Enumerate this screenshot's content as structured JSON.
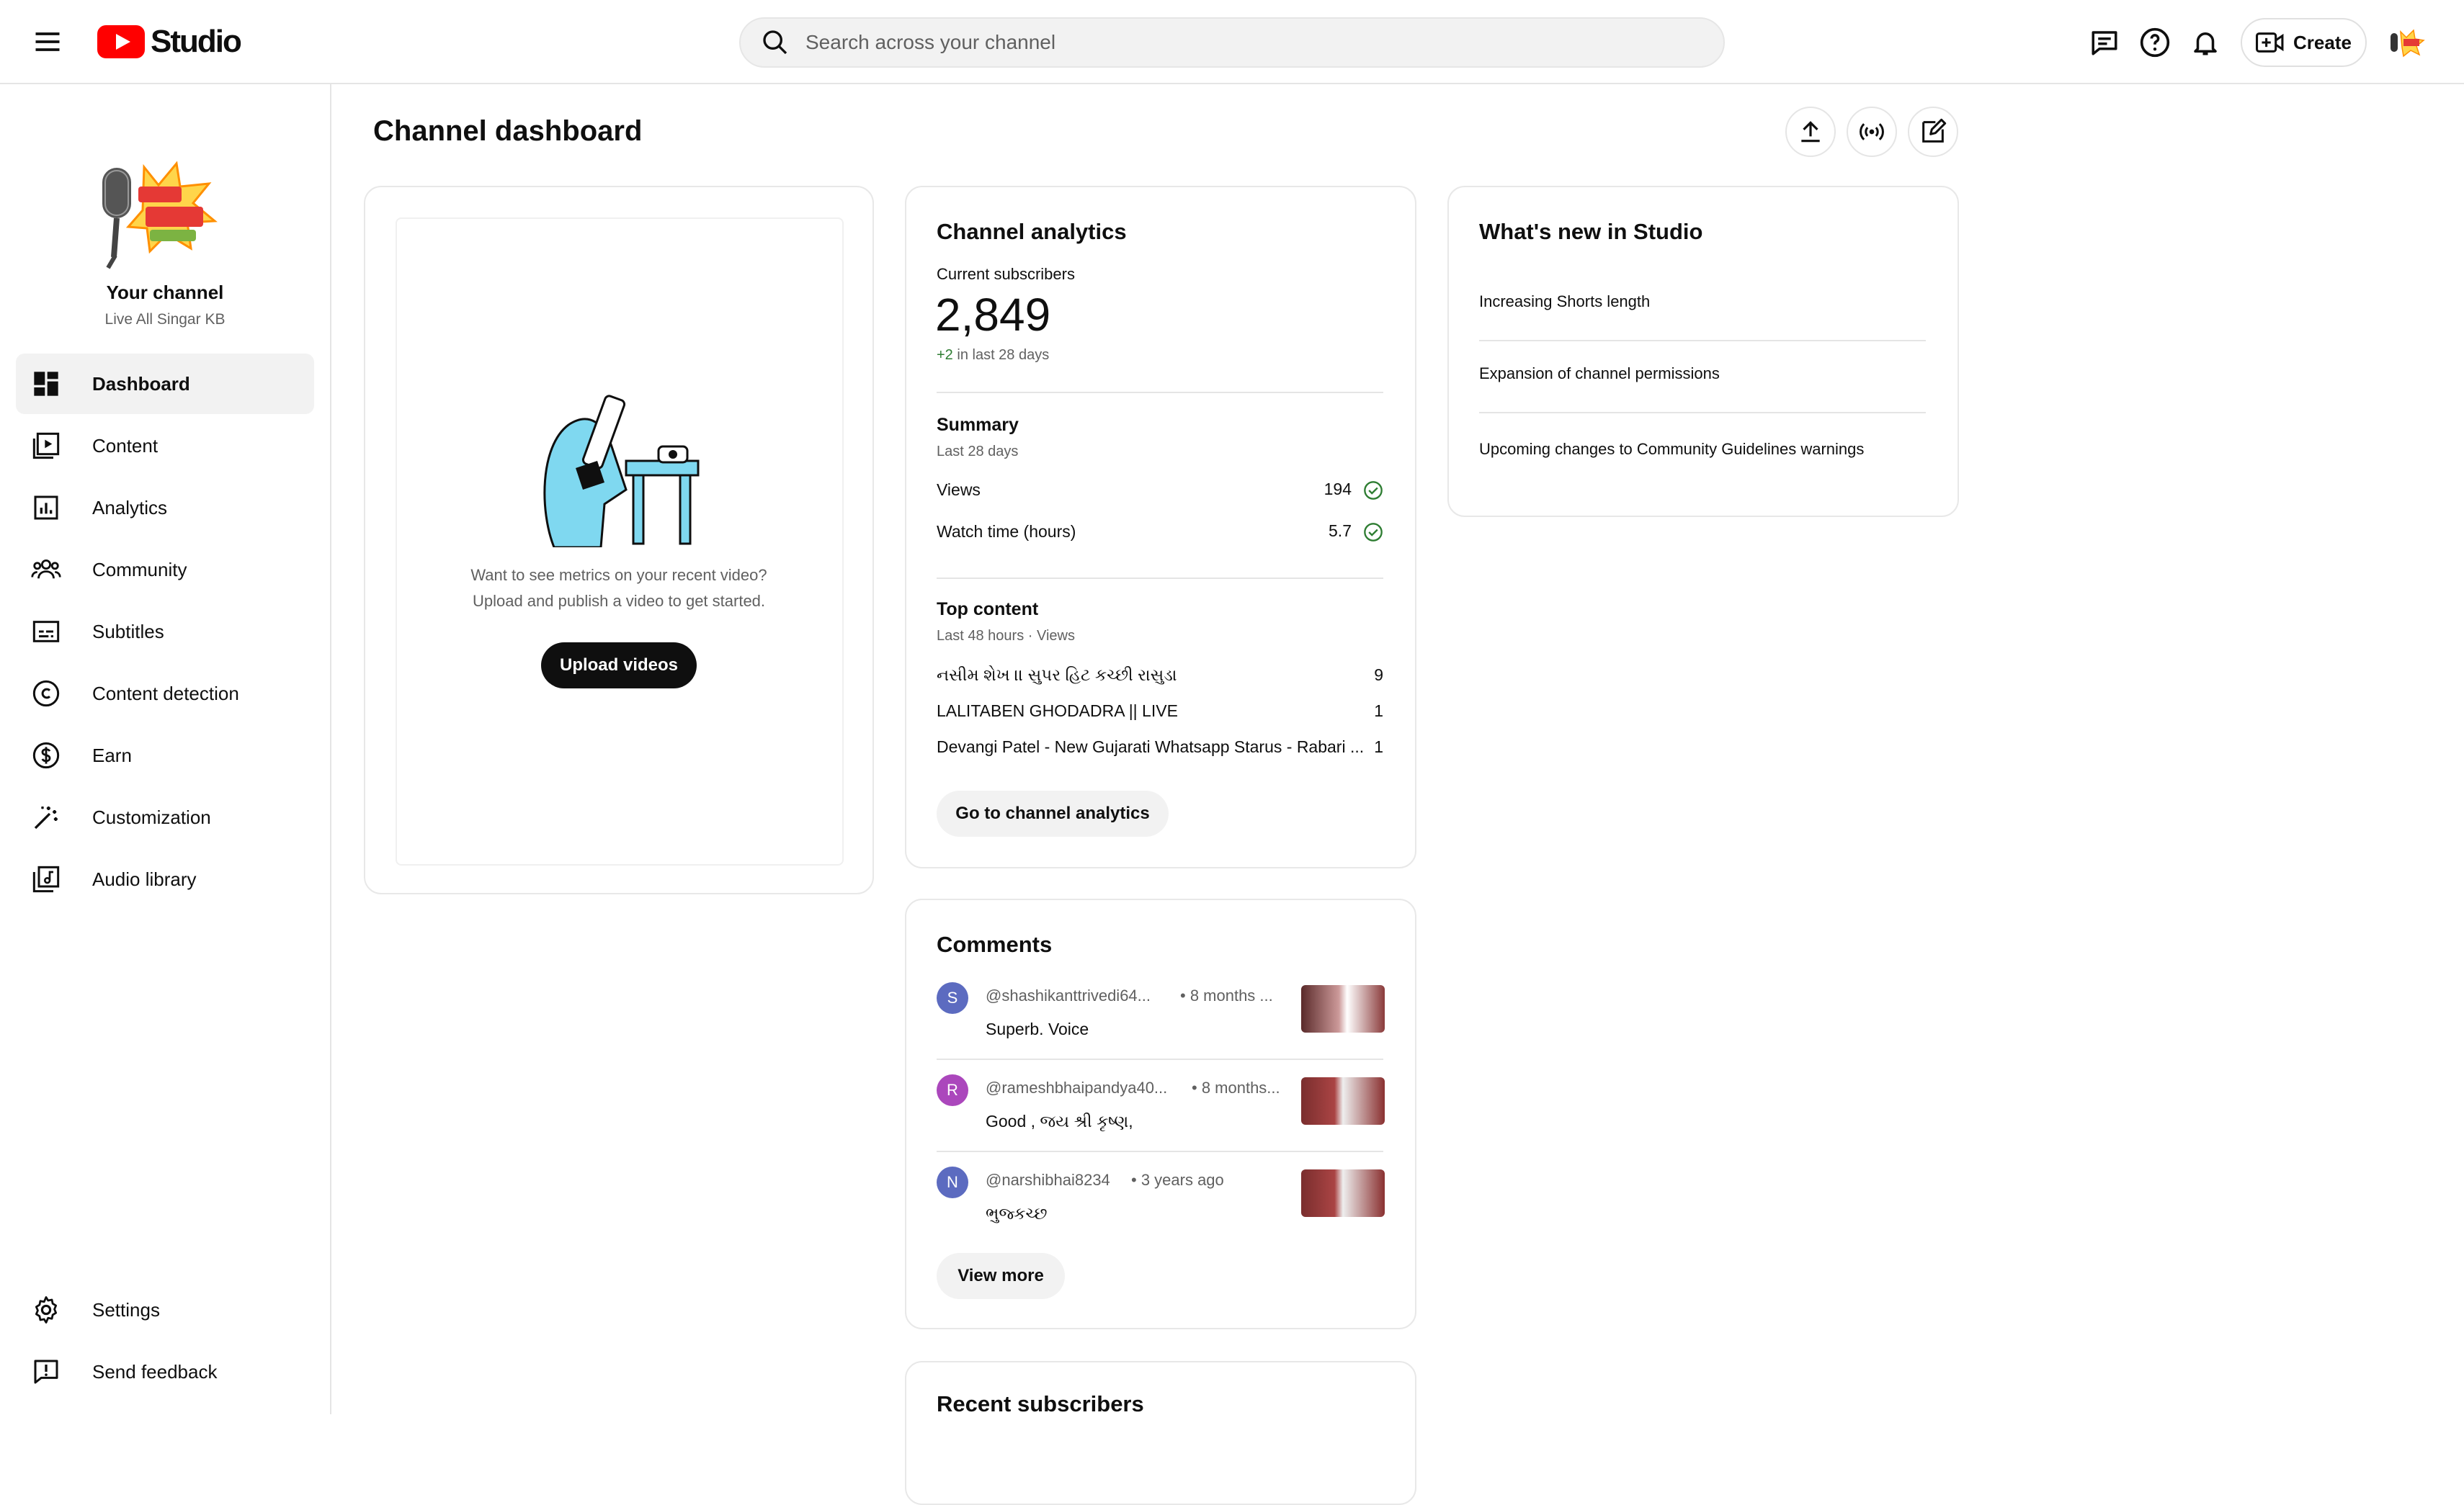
{
  "header": {
    "logo_text": "Studio",
    "search_placeholder": "Search across your channel",
    "create_label": "Create"
  },
  "sidebar": {
    "your_channel": "Your channel",
    "channel_name": "Live All Singar KB",
    "items": [
      {
        "label": "Dashboard",
        "icon": "dashboard-icon"
      },
      {
        "label": "Content",
        "icon": "content-icon"
      },
      {
        "label": "Analytics",
        "icon": "analytics-icon"
      },
      {
        "label": "Community",
        "icon": "community-icon"
      },
      {
        "label": "Subtitles",
        "icon": "subtitles-icon"
      },
      {
        "label": "Content detection",
        "icon": "copyright-icon"
      },
      {
        "label": "Earn",
        "icon": "dollar-icon"
      },
      {
        "label": "Customization",
        "icon": "magic-wand-icon"
      },
      {
        "label": "Audio library",
        "icon": "audio-library-icon"
      }
    ],
    "settings_label": "Settings",
    "feedback_label": "Send feedback"
  },
  "main": {
    "title": "Channel dashboard"
  },
  "upload_card": {
    "message_line1": "Want to see metrics on your recent video?",
    "message_line2": "Upload and publish a video to get started.",
    "button_label": "Upload videos"
  },
  "analytics": {
    "title": "Channel analytics",
    "subscribers_label": "Current subscribers",
    "subscribers_value": "2,849",
    "subscribers_delta": "+2",
    "subscribers_delta_suffix": "in last 28 days",
    "summary_title": "Summary",
    "summary_period": "Last 28 days",
    "metrics": [
      {
        "label": "Views",
        "value": "194"
      },
      {
        "label": "Watch time (hours)",
        "value": "5.7"
      }
    ],
    "top_title": "Top content",
    "top_period": "Last 48 hours · Views",
    "top_items": [
      {
        "title": "નસીમ શેખ ।। સુપર હિટ કચ્છી રાસુડા",
        "views": "9"
      },
      {
        "title": "LALITABEN GHODADRA || LIVE",
        "views": "1"
      },
      {
        "title": "Devangi Patel - New Gujarati Whatsapp Starus - Rabari ...",
        "views": "1"
      }
    ],
    "button_label": "Go to channel analytics"
  },
  "comments": {
    "title": "Comments",
    "items": [
      {
        "initial": "S",
        "author": "@shashikanttrivedi64...",
        "time": "• 8 months ...",
        "text": "Superb. Voice",
        "color": "#5c6bc0"
      },
      {
        "initial": "R",
        "author": "@rameshbhaipandya40...",
        "time": "• 8 months...",
        "text": "Good , જય શ્રી કૃષ્ણ,",
        "color": "#ab47bc"
      },
      {
        "initial": "N",
        "author": "@narshibhai8234",
        "time": "• 3 years ago",
        "text": "ભુજ્કચ્છ",
        "color": "#5c6bc0"
      }
    ],
    "button_label": "View more"
  },
  "recent_subscribers": {
    "title": "Recent subscribers"
  },
  "whats_new": {
    "title": "What's new in Studio",
    "items": [
      "Increasing Shorts length",
      "Expansion of channel permissions",
      "Upcoming changes to Community Guidelines warnings"
    ]
  },
  "colors": {
    "brand_red": "#ff0000",
    "positive_green": "#2e7d32",
    "text": "#0f0f0f",
    "muted": "#606060"
  }
}
